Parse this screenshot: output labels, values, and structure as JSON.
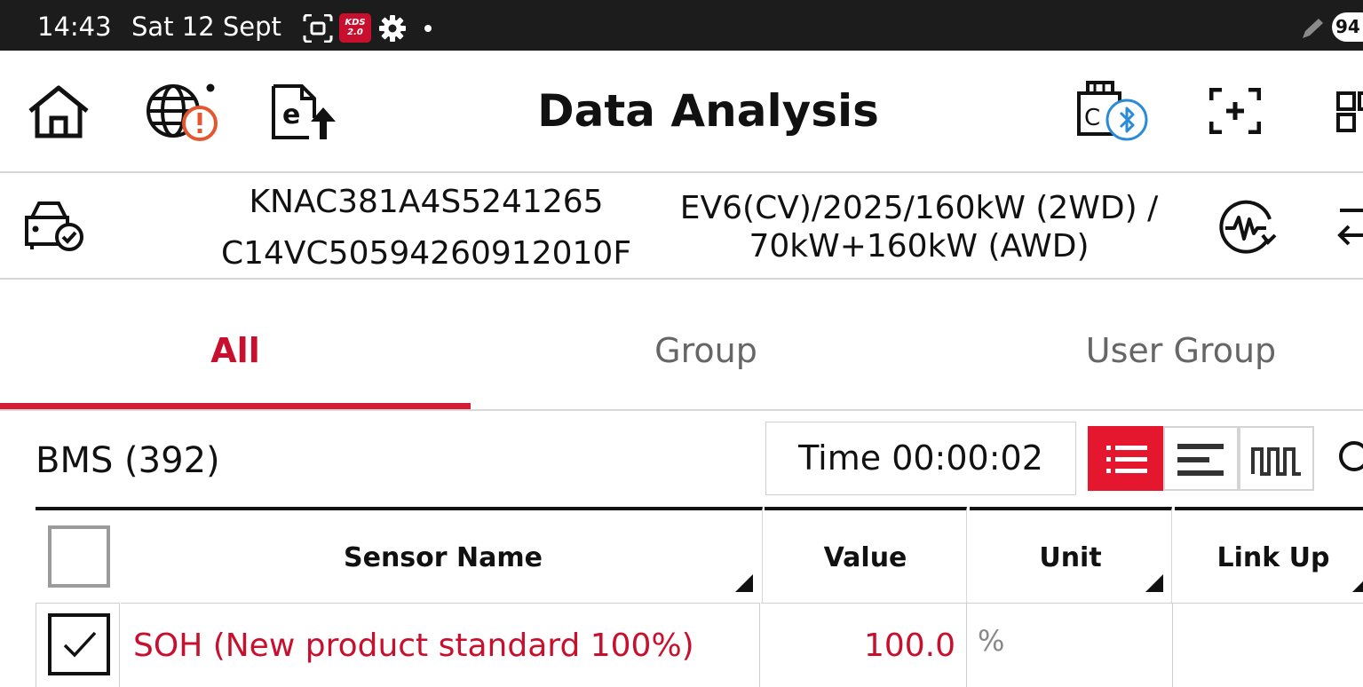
{
  "status_bar": {
    "time": "14:43",
    "date": "Sat 12 Sept",
    "app_badge": "KDS 2.0",
    "app_badge_line1": "KDS",
    "app_badge_line2": "2.0",
    "battery": "94",
    "icons": [
      "screenshot-icon",
      "kds-app-icon",
      "settings-gear-icon",
      "notification-dot-icon",
      "pen-icon",
      "battery-icon"
    ]
  },
  "header": {
    "title": "Data Analysis",
    "icons": [
      "home-icon",
      "globe-alert-icon",
      "e-upload-icon",
      "vci-bluetooth-icon",
      "scan-add-icon",
      "qr-grid-icon"
    ]
  },
  "vehicle": {
    "vin": "KNAC381A4S5241265",
    "vci_serial": "C14VC50594260912010F",
    "model_line1": "EV6(CV)/2025/160kW (2WD) /",
    "model_line2": "70kW+160kW (AWD)"
  },
  "tabs": [
    {
      "label": "All",
      "active": true
    },
    {
      "label": "Group",
      "active": false
    },
    {
      "label": "User Group",
      "active": false
    }
  ],
  "toolbar": {
    "module_label": "BMS (392)",
    "time_label": "Time 00:00:02",
    "view_modes": [
      "list-view",
      "bar-view",
      "graph-view"
    ],
    "active_view": "list-view"
  },
  "table": {
    "columns": [
      "Sensor Name",
      "Value",
      "Unit",
      "Link Up"
    ],
    "rows": [
      {
        "checked": true,
        "name": "SOH (New product standard 100%)",
        "value": "100.0",
        "unit": "%",
        "link_up": ""
      }
    ]
  },
  "colors": {
    "accent": "#d71b33",
    "sensor_text": "#c8102e",
    "status_bar_bg": "#1c1c1c"
  }
}
